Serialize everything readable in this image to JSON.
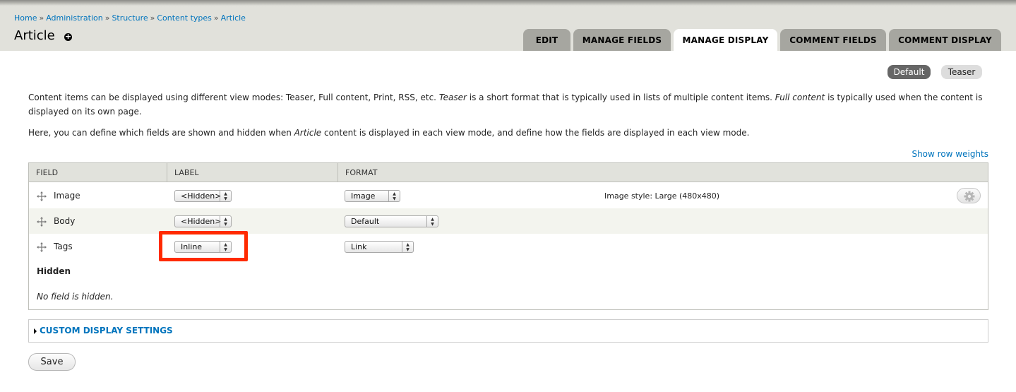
{
  "breadcrumb": {
    "items": [
      "Home",
      "Administration",
      "Structure",
      "Content types",
      "Article"
    ],
    "separator": "»"
  },
  "page": {
    "title": "Article",
    "shortcut_icon": "plus-circle-icon"
  },
  "tabs": [
    {
      "label": "EDIT",
      "active": false
    },
    {
      "label": "MANAGE FIELDS",
      "active": false
    },
    {
      "label": "MANAGE DISPLAY",
      "active": true
    },
    {
      "label": "COMMENT FIELDS",
      "active": false
    },
    {
      "label": "COMMENT DISPLAY",
      "active": false
    }
  ],
  "view_modes": {
    "default": "Default",
    "teaser": "Teaser",
    "selected": "Default"
  },
  "description": {
    "p1_a": "Content items can be displayed using different view modes: Teaser, Full content, Print, RSS, etc. ",
    "p1_em1": "Teaser",
    "p1_b": " is a short format that is typically used in lists of multiple content items. ",
    "p1_em2": "Full content",
    "p1_c": " is typically used when the content is displayed on its own page.",
    "p2_a": "Here, you can define which fields are shown and hidden when ",
    "p2_em": "Article",
    "p2_b": " content is displayed in each view mode, and define how the fields are displayed in each view mode."
  },
  "show_row_weights": "Show row weights",
  "table": {
    "headers": {
      "field": "FIELD",
      "label": "LABEL",
      "format": "FORMAT"
    },
    "rows": [
      {
        "field": "Image",
        "label": "<Hidden>",
        "format": "Image",
        "summary": "Image style: Large (480x480)",
        "has_settings": true
      },
      {
        "field": "Body",
        "label": "<Hidden>",
        "format": "Default",
        "summary": "",
        "has_settings": false
      },
      {
        "field": "Tags",
        "label": "Inline",
        "format": "Link",
        "summary": "",
        "has_settings": false,
        "highlighted": true
      }
    ],
    "hidden_heading": "Hidden",
    "hidden_empty": "No field is hidden."
  },
  "custom_display_settings": "CUSTOM DISPLAY SETTINGS",
  "save_label": "Save",
  "colors": {
    "link": "#0074bd",
    "highlight": "#ff2a00",
    "tab_inactive": "#a6a6a0",
    "header_bg": "#e1e1db"
  }
}
